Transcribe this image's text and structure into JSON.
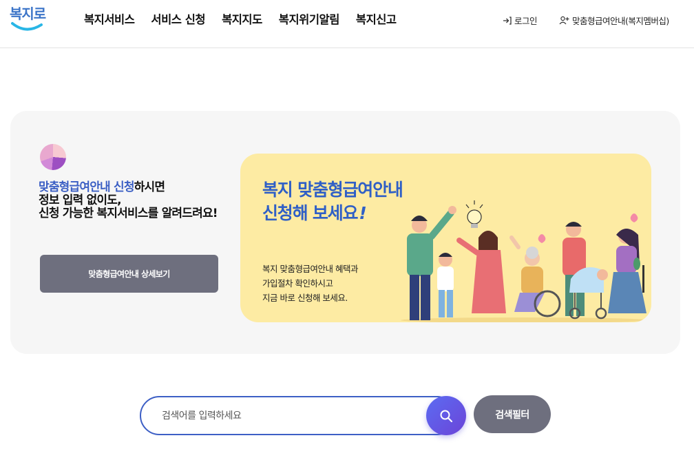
{
  "header": {
    "logo_text": "복지로",
    "nav": [
      "복지서비스",
      "서비스 신청",
      "복지지도",
      "복지위기알림",
      "복지신고"
    ],
    "login_label": "로그인",
    "member_label": "맞춤형급여안내(복지멤버십)",
    "login_icon": "login-icon",
    "member_icon": "user-add-icon"
  },
  "intro": {
    "highlight": "맞춤형급여안내 신청",
    "line1_rest": "하시면",
    "line2": "정보 입력 없이도,",
    "line3": "신청 가능한 복지서비스를 알려드려요!",
    "detail_button": "맞춤형급여안내 상세보기"
  },
  "banner": {
    "title_line1": "복지 맞춤형급여안내",
    "title_line2": "신청해 보세요",
    "title_exclaim": "!",
    "desc": [
      "복지 맞춤형급여안내 혜택과",
      "가입절차 확인하시고",
      "지금 바로 신청해 보세요."
    ]
  },
  "search": {
    "placeholder": "검색어를 입력하세요",
    "value": "",
    "search_icon": "search-icon",
    "filter_label": "검색필터"
  },
  "colors": {
    "brand_blue": "#3b5fc4",
    "button_gray": "#6e6f7e",
    "banner_bg": "#fdeba3",
    "panel_bg": "#f6f6f6",
    "search_gradient_start": "#5b6cf2",
    "search_gradient_end": "#6c44d8"
  }
}
